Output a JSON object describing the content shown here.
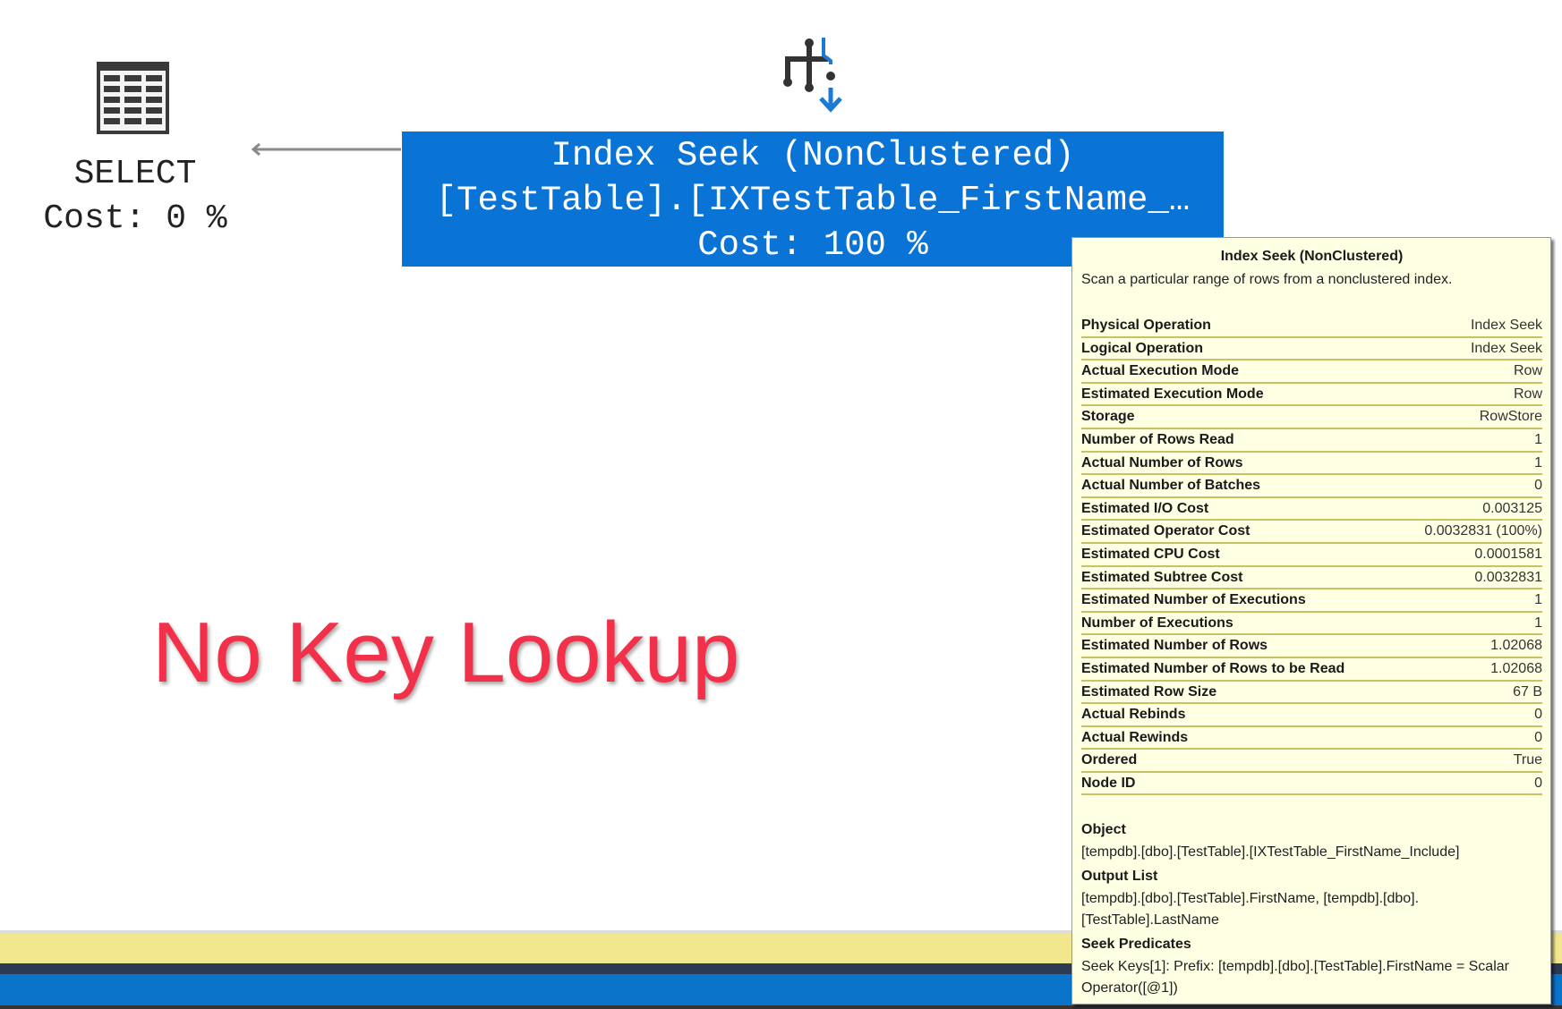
{
  "plan": {
    "select": {
      "label": "SELECT",
      "cost": "Cost: 0 %",
      "icon": "table-grid-icon"
    },
    "seek": {
      "icon": "index-seek-icon",
      "line1": "Index Seek (NonClustered)",
      "line2": "[TestTable].[IXTestTable_FirstName_…",
      "cost": "Cost: 100 %",
      "color": "#0a74d6"
    }
  },
  "annotation": {
    "text": "No Key Lookup",
    "color": "#f2304a"
  },
  "tooltip": {
    "title": "Index Seek (NonClustered)",
    "description": "Scan a particular range of rows from a nonclustered index.",
    "rows": [
      {
        "k": "Physical Operation",
        "v": "Index Seek"
      },
      {
        "k": "Logical Operation",
        "v": "Index Seek"
      },
      {
        "k": "Actual Execution Mode",
        "v": "Row"
      },
      {
        "k": "Estimated Execution Mode",
        "v": "Row"
      },
      {
        "k": "Storage",
        "v": "RowStore"
      },
      {
        "k": "Number of Rows Read",
        "v": "1"
      },
      {
        "k": "Actual Number of Rows",
        "v": "1"
      },
      {
        "k": "Actual Number of Batches",
        "v": "0"
      },
      {
        "k": "Estimated I/O Cost",
        "v": "0.003125"
      },
      {
        "k": "Estimated Operator Cost",
        "v": "0.0032831 (100%)"
      },
      {
        "k": "Estimated CPU Cost",
        "v": "0.0001581"
      },
      {
        "k": "Estimated Subtree Cost",
        "v": "0.0032831"
      },
      {
        "k": "Estimated Number of Executions",
        "v": "1"
      },
      {
        "k": "Number of Executions",
        "v": "1"
      },
      {
        "k": "Estimated Number of Rows",
        "v": "1.02068"
      },
      {
        "k": "Estimated Number of Rows to be Read",
        "v": "1.02068"
      },
      {
        "k": "Estimated Row Size",
        "v": "67 B"
      },
      {
        "k": "Actual Rebinds",
        "v": "0"
      },
      {
        "k": "Actual Rewinds",
        "v": "0"
      },
      {
        "k": "Ordered",
        "v": "True"
      },
      {
        "k": "Node ID",
        "v": "0"
      }
    ],
    "object_label": "Object",
    "object_value": "[tempdb].[dbo].[TestTable].[IXTestTable_FirstName_Include]",
    "output_label": "Output List",
    "output_value": "[tempdb].[dbo].[TestTable].FirstName, [tempdb].[dbo].[TestTable].LastName",
    "seek_label": "Seek Predicates",
    "seek_value": "Seek Keys[1]: Prefix: [tempdb].[dbo].[TestTable].FirstName = Scalar Operator([@1])"
  }
}
